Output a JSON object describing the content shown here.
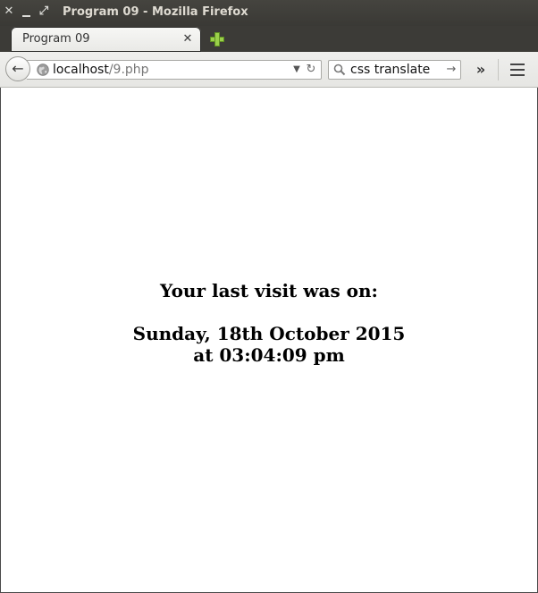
{
  "window": {
    "title": "Program 09 - Mozilla Firefox"
  },
  "tabs": [
    {
      "label": "Program 09",
      "active": true
    }
  ],
  "navbar": {
    "url_host": "localhost",
    "url_path": "/9.php",
    "search_value": "css translate"
  },
  "icons": {
    "close": "close-icon",
    "minimize": "minimize-icon",
    "maximize": "maximize-icon",
    "new_tab": "plus-icon",
    "back": "back-arrow-icon",
    "site_identity": "globe-icon",
    "history_dropdown": "chevron-down-icon",
    "reload": "reload-icon",
    "search": "magnifier-icon",
    "search_go": "arrow-right-icon",
    "overflow": "double-chevron-icon",
    "menu": "hamburger-icon"
  },
  "colors": {
    "titlebar": "#3c3b37",
    "new_tab_plus": "#9bd04a",
    "page_background": "#ffffff",
    "page_text": "#000000"
  },
  "page": {
    "heading": "Your last visit was on:",
    "date": "Sunday, 18th October 2015",
    "time": "at 03:04:09 pm"
  }
}
